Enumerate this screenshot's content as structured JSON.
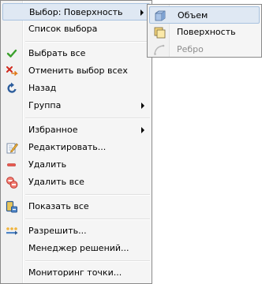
{
  "menu": {
    "items": [
      {
        "label": "Выбор: Поверхность",
        "icon": "none",
        "submenu": true
      },
      {
        "label": "Список выбора",
        "icon": "none"
      },
      {
        "label": "Выбрать все",
        "icon": "check-icon"
      },
      {
        "label": "Отменить выбор всех",
        "icon": "unselect-icon"
      },
      {
        "label": "Назад",
        "icon": "back-icon"
      },
      {
        "label": "Группа",
        "icon": "none",
        "submenu": true
      },
      {
        "label": "Избранное",
        "icon": "none",
        "submenu": true
      },
      {
        "label": "Редактировать...",
        "icon": "edit-icon"
      },
      {
        "label": "Удалить",
        "icon": "minus-icon"
      },
      {
        "label": "Удалить все",
        "icon": "delete-all-icon"
      },
      {
        "label": "Показать все",
        "icon": "show-all-icon"
      },
      {
        "label": "Разрешить...",
        "icon": "resolve-icon"
      },
      {
        "label": "Менеджер решений...",
        "icon": "none"
      },
      {
        "label": "Мониторинг точки...",
        "icon": "none"
      }
    ]
  },
  "submenu": {
    "items": [
      {
        "label": "Объем",
        "icon": "volume-icon"
      },
      {
        "label": "Поверхность",
        "icon": "surface-icon"
      },
      {
        "label": "Ребро",
        "icon": "edge-icon",
        "disabled": true
      }
    ]
  },
  "colors": {
    "highlight_bg": "#dfe8f3",
    "highlight_border": "#a8c2df",
    "menu_bg": "#f5f5f5"
  }
}
